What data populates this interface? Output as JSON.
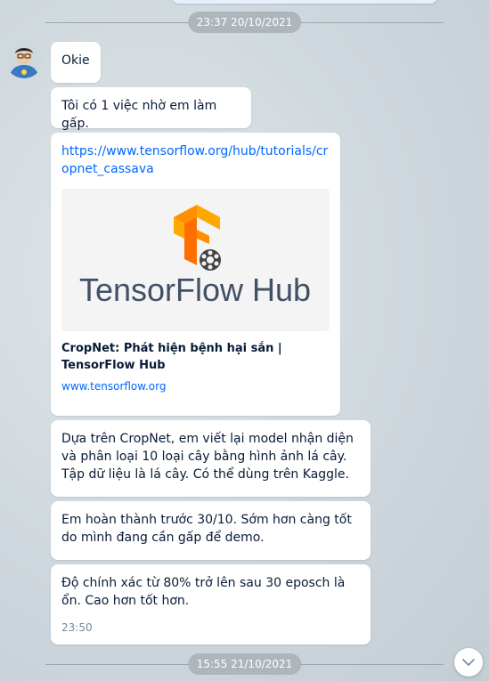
{
  "dividers": {
    "first": "23:37 20/10/2021",
    "second": "15:55 21/10/2021"
  },
  "messages": [
    {
      "text": "Okie"
    },
    {
      "text": "Tôi có 1 việc nhờ em làm gấp."
    },
    {
      "link": "https://www.tensorflow.org/hub/tutorials/cropnet_cassava",
      "preview_title": "CropNet: Phát hiện bệnh hại sắn  |  TensorFlow Hub",
      "preview_domain": "www.tensorflow.org",
      "preview_image_text": "TensorFlow Hub"
    },
    {
      "text": "Dựa trên CropNet, em viết lại model nhận diện và phân loại 10 loại cây bằng hình ảnh lá cây. Tập dữ liệu là lá cây. Có thể dùng trên Kaggle."
    },
    {
      "text": "Em hoàn thành trước 30/10. Sớm hơn càng tốt do mình đang cần gấp để demo."
    },
    {
      "text": "Độ chính xác từ 80% trở lên sau 30 eposch là ổn. Cao hơn tốt hơn.",
      "time": "23:50"
    }
  ],
  "icons": {
    "avatar": "user-avatar",
    "scroll_down": "chevron-down-icon",
    "tensorflow_logo": "tensorflow-logo"
  },
  "colors": {
    "link": "#0068ff",
    "tensorflow_orange": "#ff8f00"
  }
}
